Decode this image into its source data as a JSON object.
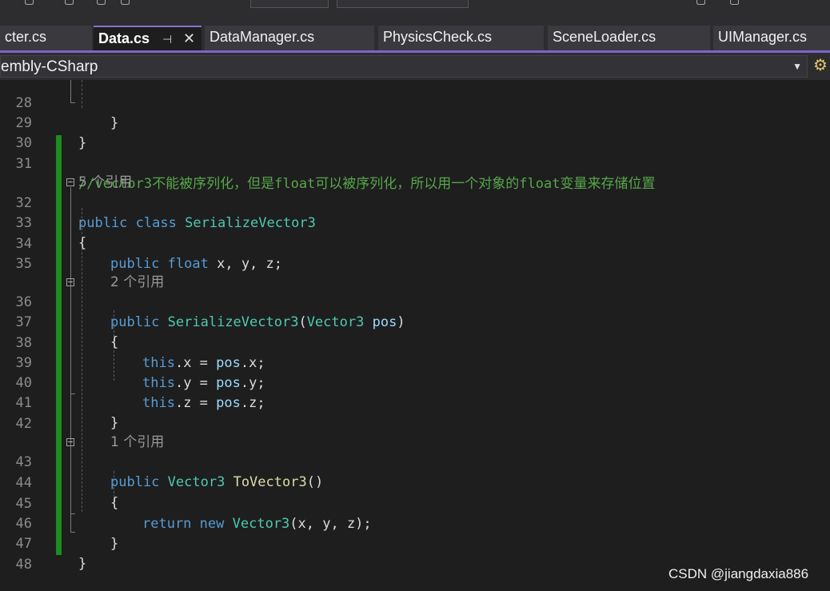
{
  "tabs": [
    {
      "label": "cter.cs"
    },
    {
      "label": "Data.cs",
      "active": true,
      "pin": "⊣",
      "close": "✕"
    },
    {
      "label": "DataManager.cs"
    },
    {
      "label": "PhysicsCheck.cs"
    },
    {
      "label": "SceneLoader.cs"
    },
    {
      "label": "UIManager.cs"
    }
  ],
  "project_dropdown": {
    "label": "embly-CSharp",
    "arrow": "▼"
  },
  "nav_icon": "⚙",
  "code": {
    "lines": [
      {
        "num": "28",
        "text": "}"
      },
      {
        "num": "29",
        "text": "}"
      },
      {
        "num": "30",
        "text": ""
      },
      {
        "num": "31",
        "comment": "//vector3不能被序列化，但是float可以被序列化，所以用一个对象的float变量来存储位置"
      },
      {
        "ref": "5 个引用"
      },
      {
        "num": "32",
        "kw1": "public",
        "kw2": "class",
        "type": "SerializeVector3"
      },
      {
        "num": "33",
        "text": "{"
      },
      {
        "num": "34",
        "kw1": "public",
        "kw2": "float",
        "rest": "x, y, z;"
      },
      {
        "num": "35",
        "text": ""
      },
      {
        "ref": "2 个引用"
      },
      {
        "num": "36",
        "kw1": "public",
        "type": "SerializeVector3",
        "open": "(",
        "ptype": "Vector3",
        "param": "pos",
        "close": ")"
      },
      {
        "num": "37",
        "text": "{"
      },
      {
        "num": "38",
        "kw1": "this",
        "rest": ".x = ",
        "var": "pos",
        "tail": ".x;"
      },
      {
        "num": "39",
        "kw1": "this",
        "rest": ".y = ",
        "var": "pos",
        "tail": ".y;"
      },
      {
        "num": "40",
        "kw1": "this",
        "rest": ".z = ",
        "var": "pos",
        "tail": ".z;"
      },
      {
        "num": "41",
        "text": "}"
      },
      {
        "num": "42",
        "text": ""
      },
      {
        "ref": "1 个引用"
      },
      {
        "num": "43",
        "kw1": "public",
        "type": "Vector3",
        "fn": "ToVector3",
        "parens": "()"
      },
      {
        "num": "44",
        "text": "{"
      },
      {
        "num": "45",
        "kw1": "return",
        "kw2": "new",
        "type": "Vector3",
        "rest": "(x, y, z);"
      },
      {
        "num": "46",
        "text": "}"
      },
      {
        "num": "47",
        "text": "}"
      },
      {
        "num": "48",
        "text": ""
      }
    ]
  },
  "fold_glyph": "−",
  "watermark": "CSDN @jiangdaxia886"
}
